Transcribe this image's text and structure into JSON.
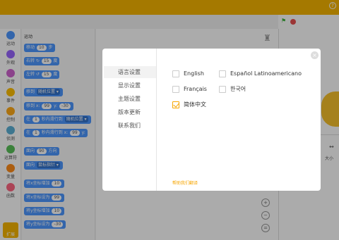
{
  "header": {
    "help": "?"
  },
  "categories": [
    {
      "label": "运动",
      "color": "#4c97ff"
    },
    {
      "label": "外观",
      "color": "#9966ff"
    },
    {
      "label": "声音",
      "color": "#cf63cf"
    },
    {
      "label": "事件",
      "color": "#ffbf00"
    },
    {
      "label": "控制",
      "color": "#ffab19"
    },
    {
      "label": "侦测",
      "color": "#5cb1d6"
    },
    {
      "label": "运算符",
      "color": "#59c059"
    },
    {
      "label": "变量",
      "color": "#ff8c1a"
    },
    {
      "label": "函数",
      "color": "#ff6680"
    }
  ],
  "library_button": "扩展",
  "palette": {
    "title": "运动",
    "blocks": [
      {
        "text": "移动",
        "arg": "10",
        "suffix": "步"
      },
      {
        "text": "右转 ↻",
        "arg": "15",
        "suffix": "度"
      },
      {
        "text": "左转 ↺",
        "arg": "15",
        "suffix": "度"
      },
      {
        "text": "移到",
        "drop": "随机位置 ▾"
      },
      {
        "text": "移到 x:",
        "arg": "99",
        "suffix": "y:",
        "arg2": "-30"
      },
      {
        "text": "在",
        "arg": "1",
        "suffix": "秒内滑行到",
        "drop": "随机位置 ▾"
      },
      {
        "text": "在",
        "arg": "1",
        "suffix": "秒内滑行到 x:",
        "arg2": "99",
        "suffix2": "y:"
      },
      {
        "text": "面向",
        "arg": "90",
        "suffix": "方向"
      },
      {
        "text": "面向",
        "drop": "鼠标指针 ▾"
      },
      {
        "text": "将x坐标增加",
        "arg": "10"
      },
      {
        "text": "将x坐标设为",
        "arg": "99"
      },
      {
        "text": "将y坐标增加",
        "arg": "10"
      },
      {
        "text": "将y坐标设为",
        "arg": "-30"
      }
    ]
  },
  "workspace": {
    "zoom_in": "+",
    "zoom_out": "−",
    "reset": "="
  },
  "stage": {
    "size_label": "大小",
    "arrows": "↔"
  },
  "settings_dialog": {
    "close": "×",
    "menu": [
      "语言设置",
      "显示设置",
      "主题设置",
      "版本更新",
      "联系我们"
    ],
    "active_menu": "语言设置",
    "languages": [
      {
        "label": "English",
        "checked": false
      },
      {
        "label": "Español Latinoamericano",
        "checked": false
      },
      {
        "label": "Français",
        "checked": false
      },
      {
        "label": "한국어",
        "checked": false
      },
      {
        "label": "简体中文",
        "checked": true
      }
    ],
    "help_translate": "帮助我们翻译"
  },
  "colors": {
    "brand": "#f7b500",
    "accent": "#f7a600",
    "motion": "#4c97ff"
  }
}
